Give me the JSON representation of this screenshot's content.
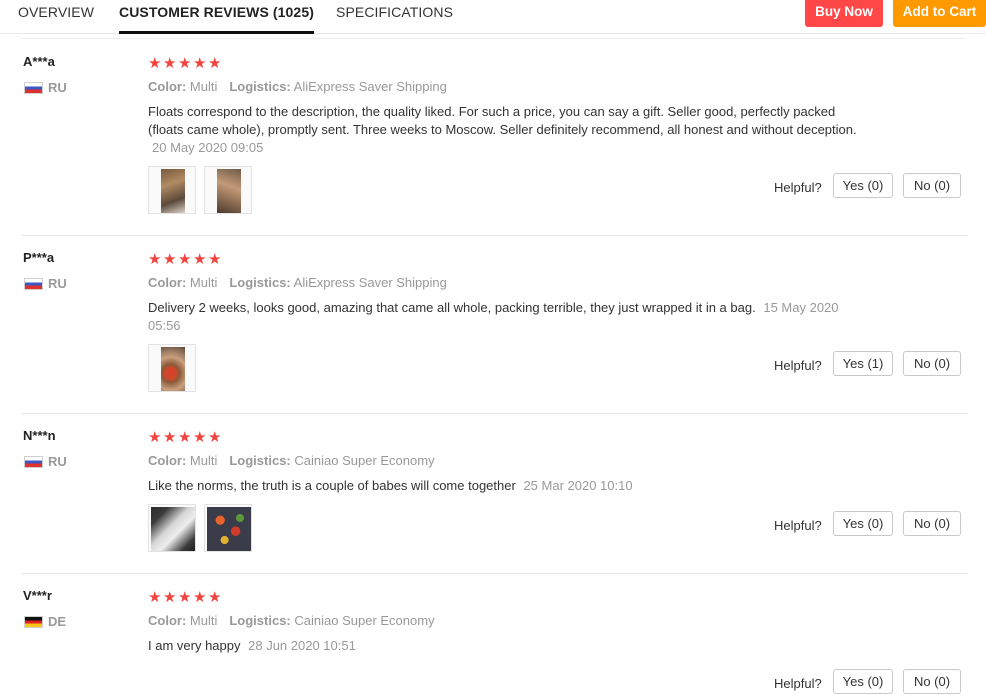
{
  "tabs": [
    {
      "label": "OVERVIEW",
      "active": false
    },
    {
      "label": "CUSTOMER REVIEWS (1025)",
      "active": true
    },
    {
      "label": "SPECIFICATIONS",
      "active": false
    }
  ],
  "actions": {
    "buy_now": "Buy Now",
    "add_to_cart": "Add to Cart"
  },
  "colors": {
    "buy_now": "#ff4747",
    "add_to_cart": "#ff9900",
    "stars": "#f0443d"
  },
  "labels": {
    "color": "Color:",
    "logistics": "Logistics:",
    "helpful": "Helpful?"
  },
  "reviews": [
    {
      "user": "A***a",
      "country": "RU",
      "rating": 5,
      "color": "Multi",
      "logistics": "AliExpress Saver Shipping",
      "text": "Floats correspond to the description, the quality liked. For such a price, you can say a gift. Seller good, perfectly packed (floats came whole), promptly sent. Three weeks to Moscow. Seller definitely recommend, all honest and without deception.",
      "date": "20 May 2020 09:05",
      "yes": "Yes (0)",
      "no": "No (0)"
    },
    {
      "user": "P***a",
      "country": "RU",
      "rating": 5,
      "color": "Multi",
      "logistics": "AliExpress Saver Shipping",
      "text": "Delivery 2 weeks, looks good, amazing that came all whole, packing terrible, they just wrapped it in a bag.",
      "date": "15 May 2020 05:56",
      "yes": "Yes (1)",
      "no": "No (0)"
    },
    {
      "user": "N***n",
      "country": "RU",
      "rating": 5,
      "color": "Multi",
      "logistics": "Cainiao Super Economy",
      "text": "Like the norms, the truth is a couple of babes will come together",
      "date": "25 Mar 2020 10:10",
      "yes": "Yes (0)",
      "no": "No (0)"
    },
    {
      "user": "V***r",
      "country": "DE",
      "rating": 5,
      "color": "Multi",
      "logistics": "Cainiao Super Economy",
      "text": "I am very happy",
      "date": "28 Jun 2020 10:51",
      "yes": "Yes (0)",
      "no": "No (0)"
    }
  ]
}
